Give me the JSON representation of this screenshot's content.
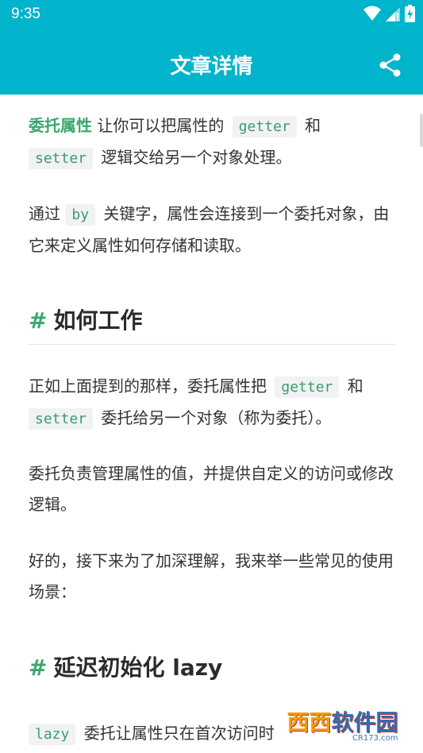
{
  "status": {
    "time": "9:35"
  },
  "appbar": {
    "title": "文章详情"
  },
  "article": {
    "p1": {
      "a": "委托属性",
      "b": " 让你可以把属性的 ",
      "c": "getter",
      "d": " 和 ",
      "e": "setter",
      "f": " 逻辑交给另一个对象处理。"
    },
    "p2": {
      "a": "通过 ",
      "b": "by",
      "c": " 关键字，属性会连接到一个委托对象，由它来定义属性如何存储和读取。"
    },
    "h1": {
      "hash": "#",
      "text": "如何工作"
    },
    "p3": {
      "a": "正如上面提到的那样，委托属性把 ",
      "b": "getter",
      "c": " 和 ",
      "d": "setter",
      "e": " 委托给另一个对象（称为委托）。"
    },
    "p4": "委托负责管理属性的值，并提供自定义的访问或修改逻辑。",
    "p5": "好的，接下来为了加深理解，我来举一些常见的使用场景：",
    "h2": {
      "hash": "#",
      "text": "延迟初始化 lazy"
    },
    "p6": {
      "a": "lazy",
      "b": " 委托让属性只在首次访问时"
    }
  },
  "watermark": {
    "logo": "西西",
    "sub": "CR173.com",
    "name": "软件园"
  },
  "icons": {
    "wifi": "wifi-icon",
    "signal": "signal-icon",
    "battery": "battery-icon",
    "share": "share-icon"
  },
  "colors": {
    "primary": "#00b4cc",
    "accent": "#3aa76d",
    "code_bg": "#f1f2f3"
  }
}
